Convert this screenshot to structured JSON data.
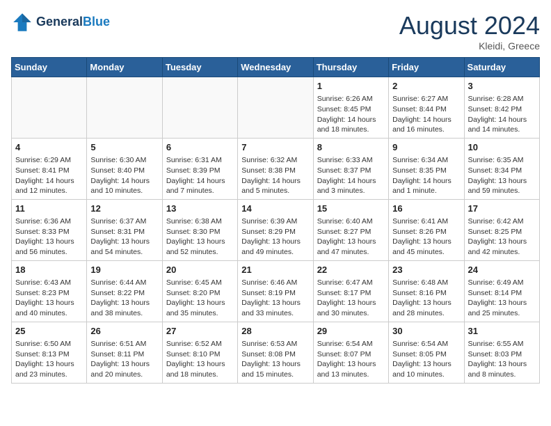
{
  "header": {
    "logo_line1": "General",
    "logo_line2": "Blue",
    "month": "August 2024",
    "location": "Kleidi, Greece"
  },
  "weekdays": [
    "Sunday",
    "Monday",
    "Tuesday",
    "Wednesday",
    "Thursday",
    "Friday",
    "Saturday"
  ],
  "weeks": [
    [
      {
        "day": "",
        "info": ""
      },
      {
        "day": "",
        "info": ""
      },
      {
        "day": "",
        "info": ""
      },
      {
        "day": "",
        "info": ""
      },
      {
        "day": "1",
        "info": "Sunrise: 6:26 AM\nSunset: 8:45 PM\nDaylight: 14 hours\nand 18 minutes."
      },
      {
        "day": "2",
        "info": "Sunrise: 6:27 AM\nSunset: 8:44 PM\nDaylight: 14 hours\nand 16 minutes."
      },
      {
        "day": "3",
        "info": "Sunrise: 6:28 AM\nSunset: 8:42 PM\nDaylight: 14 hours\nand 14 minutes."
      }
    ],
    [
      {
        "day": "4",
        "info": "Sunrise: 6:29 AM\nSunset: 8:41 PM\nDaylight: 14 hours\nand 12 minutes."
      },
      {
        "day": "5",
        "info": "Sunrise: 6:30 AM\nSunset: 8:40 PM\nDaylight: 14 hours\nand 10 minutes."
      },
      {
        "day": "6",
        "info": "Sunrise: 6:31 AM\nSunset: 8:39 PM\nDaylight: 14 hours\nand 7 minutes."
      },
      {
        "day": "7",
        "info": "Sunrise: 6:32 AM\nSunset: 8:38 PM\nDaylight: 14 hours\nand 5 minutes."
      },
      {
        "day": "8",
        "info": "Sunrise: 6:33 AM\nSunset: 8:37 PM\nDaylight: 14 hours\nand 3 minutes."
      },
      {
        "day": "9",
        "info": "Sunrise: 6:34 AM\nSunset: 8:35 PM\nDaylight: 14 hours\nand 1 minute."
      },
      {
        "day": "10",
        "info": "Sunrise: 6:35 AM\nSunset: 8:34 PM\nDaylight: 13 hours\nand 59 minutes."
      }
    ],
    [
      {
        "day": "11",
        "info": "Sunrise: 6:36 AM\nSunset: 8:33 PM\nDaylight: 13 hours\nand 56 minutes."
      },
      {
        "day": "12",
        "info": "Sunrise: 6:37 AM\nSunset: 8:31 PM\nDaylight: 13 hours\nand 54 minutes."
      },
      {
        "day": "13",
        "info": "Sunrise: 6:38 AM\nSunset: 8:30 PM\nDaylight: 13 hours\nand 52 minutes."
      },
      {
        "day": "14",
        "info": "Sunrise: 6:39 AM\nSunset: 8:29 PM\nDaylight: 13 hours\nand 49 minutes."
      },
      {
        "day": "15",
        "info": "Sunrise: 6:40 AM\nSunset: 8:27 PM\nDaylight: 13 hours\nand 47 minutes."
      },
      {
        "day": "16",
        "info": "Sunrise: 6:41 AM\nSunset: 8:26 PM\nDaylight: 13 hours\nand 45 minutes."
      },
      {
        "day": "17",
        "info": "Sunrise: 6:42 AM\nSunset: 8:25 PM\nDaylight: 13 hours\nand 42 minutes."
      }
    ],
    [
      {
        "day": "18",
        "info": "Sunrise: 6:43 AM\nSunset: 8:23 PM\nDaylight: 13 hours\nand 40 minutes."
      },
      {
        "day": "19",
        "info": "Sunrise: 6:44 AM\nSunset: 8:22 PM\nDaylight: 13 hours\nand 38 minutes."
      },
      {
        "day": "20",
        "info": "Sunrise: 6:45 AM\nSunset: 8:20 PM\nDaylight: 13 hours\nand 35 minutes."
      },
      {
        "day": "21",
        "info": "Sunrise: 6:46 AM\nSunset: 8:19 PM\nDaylight: 13 hours\nand 33 minutes."
      },
      {
        "day": "22",
        "info": "Sunrise: 6:47 AM\nSunset: 8:17 PM\nDaylight: 13 hours\nand 30 minutes."
      },
      {
        "day": "23",
        "info": "Sunrise: 6:48 AM\nSunset: 8:16 PM\nDaylight: 13 hours\nand 28 minutes."
      },
      {
        "day": "24",
        "info": "Sunrise: 6:49 AM\nSunset: 8:14 PM\nDaylight: 13 hours\nand 25 minutes."
      }
    ],
    [
      {
        "day": "25",
        "info": "Sunrise: 6:50 AM\nSunset: 8:13 PM\nDaylight: 13 hours\nand 23 minutes."
      },
      {
        "day": "26",
        "info": "Sunrise: 6:51 AM\nSunset: 8:11 PM\nDaylight: 13 hours\nand 20 minutes."
      },
      {
        "day": "27",
        "info": "Sunrise: 6:52 AM\nSunset: 8:10 PM\nDaylight: 13 hours\nand 18 minutes."
      },
      {
        "day": "28",
        "info": "Sunrise: 6:53 AM\nSunset: 8:08 PM\nDaylight: 13 hours\nand 15 minutes."
      },
      {
        "day": "29",
        "info": "Sunrise: 6:54 AM\nSunset: 8:07 PM\nDaylight: 13 hours\nand 13 minutes."
      },
      {
        "day": "30",
        "info": "Sunrise: 6:54 AM\nSunset: 8:05 PM\nDaylight: 13 hours\nand 10 minutes."
      },
      {
        "day": "31",
        "info": "Sunrise: 6:55 AM\nSunset: 8:03 PM\nDaylight: 13 hours\nand 8 minutes."
      }
    ]
  ]
}
